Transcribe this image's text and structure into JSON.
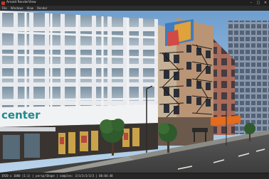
{
  "window": {
    "title": "Arnold RenderView",
    "controls": {
      "minimize": "–",
      "maximize": "□",
      "close": "✕"
    }
  },
  "menu": {
    "items": [
      "File",
      "Windows",
      "View",
      "Render"
    ]
  },
  "viewport": {
    "store_sign": "center"
  },
  "status": {
    "text": "1920 x 1080 (1:1) | persp/Shape | samples: 3/3/3/3/3/3 | 00:04:48"
  },
  "colors": {
    "title_bg": "#1f1f1f",
    "menu_bg": "#2d2d2d",
    "status_bg": "#262626",
    "sign_teal": "#1f8a8c"
  },
  "icons": [
    "arnold-logo-icon",
    "minimize-icon",
    "maximize-icon",
    "close-icon"
  ]
}
